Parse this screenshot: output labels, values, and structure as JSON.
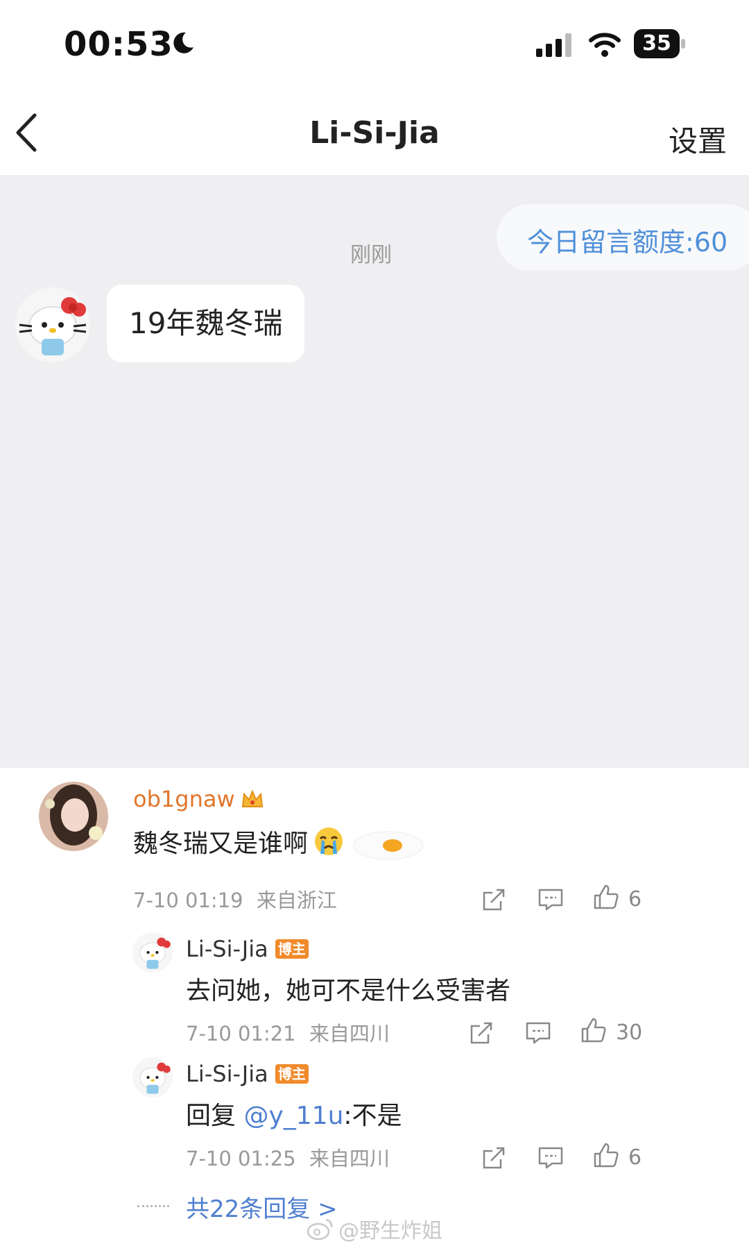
{
  "status_bar": {
    "time": "00:53",
    "battery": "35"
  },
  "nav": {
    "title": "Li-Si-Jia",
    "settings_label": "设置"
  },
  "chat": {
    "timestamp": "刚刚",
    "quota_label": "今日留言额度:60",
    "message": "19年魏冬瑞"
  },
  "comment": {
    "username": "ob1gnaw",
    "text": "魏冬瑞又是谁啊",
    "time": "7-10 01:19",
    "location": "来自浙江",
    "likes": "6"
  },
  "replies": [
    {
      "username": "Li-Si-Jia",
      "badge": "博主",
      "text": "去问她，她可不是什么受害者",
      "time": "7-10 01:21",
      "location": "来自四川",
      "likes": "30"
    },
    {
      "username": "Li-Si-Jia",
      "badge": "博主",
      "prefix": "回复 ",
      "mention": "@y_11u",
      "suffix": ":不是",
      "time": "7-10 01:25",
      "location": "来自四川",
      "likes": "6"
    }
  ],
  "more_replies_label": "共22条回复 >",
  "watermark": "@野生炸姐",
  "colors": {
    "link": "#4f7fd0",
    "username_orange": "#e0762b",
    "badge": "#f08a2b",
    "chat_bg": "#efeff2"
  },
  "icons": [
    "moon-icon",
    "signal-icon",
    "wifi-icon",
    "battery-icon",
    "back-chevron-icon",
    "share-icon",
    "comment-icon",
    "like-icon",
    "crown-icon",
    "crying-emoji-icon",
    "weibo-logo-icon"
  ]
}
